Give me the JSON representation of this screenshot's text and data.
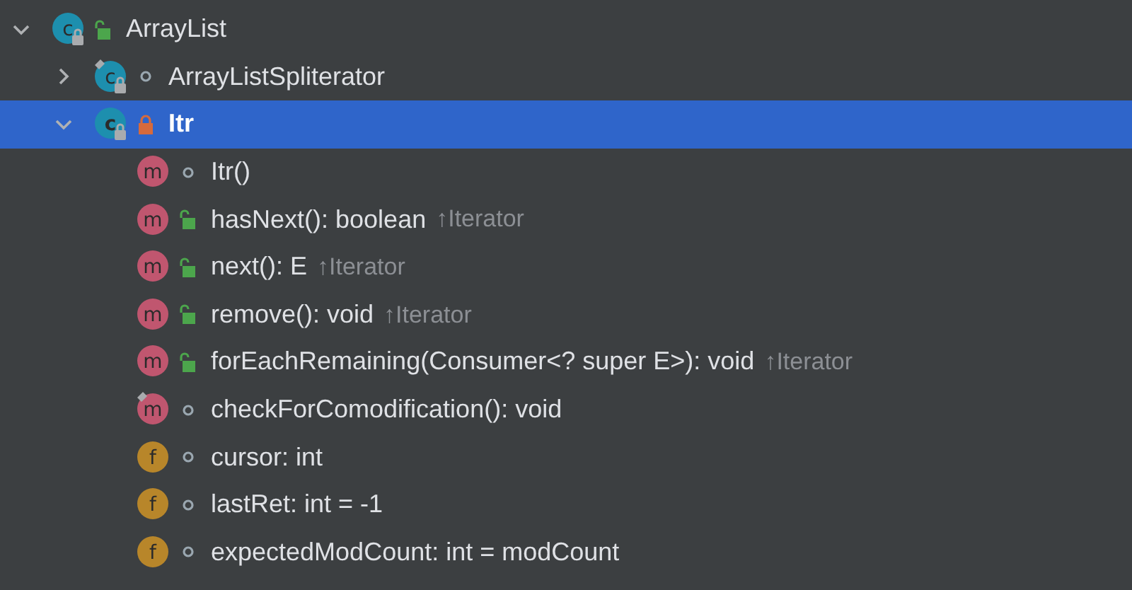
{
  "tree": [
    {
      "kind": "class",
      "letter": "c",
      "name": "ArrayList",
      "access": {
        "kind": "public"
      },
      "marked": false,
      "expanded": true,
      "selected": false,
      "children": [
        {
          "kind": "class",
          "letter": "c",
          "name": "ArrayListSpliterator",
          "access": {
            "kind": "package"
          },
          "marked": true,
          "expanded": false,
          "selected": false
        },
        {
          "kind": "class",
          "letter": "c",
          "name": "Itr",
          "access": {
            "kind": "private"
          },
          "marked": false,
          "expanded": true,
          "selected": true,
          "children": [
            {
              "kind": "method",
              "letter": "m",
              "name": "Itr()",
              "access": {
                "kind": "package"
              },
              "marked": false,
              "selected": false
            },
            {
              "kind": "method",
              "letter": "m",
              "name": "hasNext(): boolean",
              "inherited": "↑Iterator",
              "access": {
                "kind": "public"
              },
              "marked": false,
              "selected": false
            },
            {
              "kind": "method",
              "letter": "m",
              "name": "next(): E",
              "inherited": "↑Iterator",
              "access": {
                "kind": "public"
              },
              "marked": false,
              "selected": false
            },
            {
              "kind": "method",
              "letter": "m",
              "name": "remove(): void",
              "inherited": "↑Iterator",
              "access": {
                "kind": "public"
              },
              "marked": false,
              "selected": false
            },
            {
              "kind": "method",
              "letter": "m",
              "name": "forEachRemaining(Consumer<? super E>): void",
              "inherited": "↑Iterator",
              "access": {
                "kind": "public"
              },
              "marked": false,
              "selected": false
            },
            {
              "kind": "method",
              "letter": "m",
              "name": "checkForComodification(): void",
              "access": {
                "kind": "package"
              },
              "marked": true,
              "selected": false
            },
            {
              "kind": "field",
              "letter": "f",
              "name": "cursor: int",
              "access": {
                "kind": "package"
              },
              "marked": false,
              "selected": false
            },
            {
              "kind": "field",
              "letter": "f",
              "name": "lastRet: int = -1",
              "access": {
                "kind": "package"
              },
              "marked": false,
              "selected": false
            },
            {
              "kind": "field",
              "letter": "f",
              "name": "expectedModCount: int = modCount",
              "access": {
                "kind": "package"
              },
              "marked": false,
              "selected": false
            }
          ]
        }
      ]
    }
  ]
}
